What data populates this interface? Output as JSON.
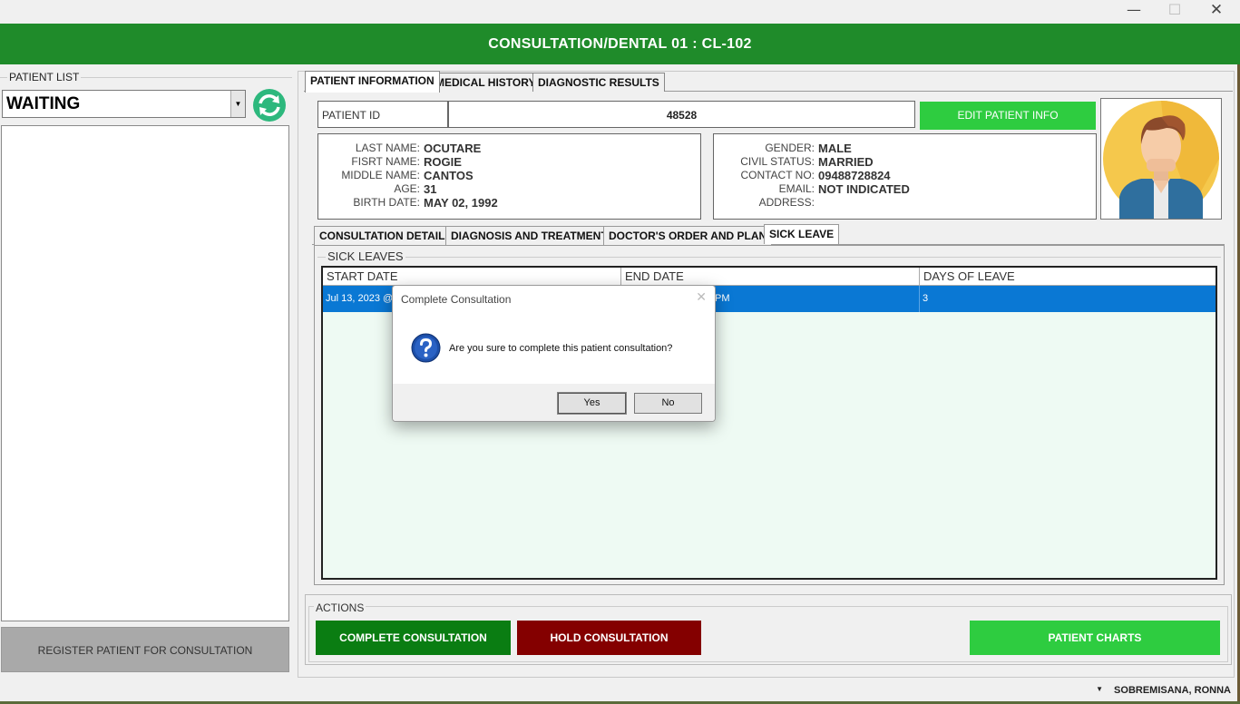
{
  "window": {
    "title": "CONSULTATION/DENTAL 01 : CL-102",
    "min_glyph": "—",
    "max_glyph": "☐",
    "close_glyph": "✕"
  },
  "patient_list": {
    "label": "PATIENT LIST",
    "filter_value": "WAITING",
    "dropdown_glyph": "▼",
    "refresh_icon": "refresh-icon",
    "register_button": "REGISTER PATIENT FOR CONSULTATION"
  },
  "tabs": [
    "PATIENT INFORMATION",
    "MEDICAL HISTORY",
    "DIAGNOSTIC RESULTS"
  ],
  "patient": {
    "id_label": "PATIENT ID",
    "id_value": "48528",
    "edit_button": "EDIT PATIENT INFO",
    "left_fields": [
      {
        "label": "LAST NAME:",
        "value": "OCUTARE"
      },
      {
        "label": "FISRT NAME:",
        "value": "ROGIE"
      },
      {
        "label": "MIDDLE NAME:",
        "value": "CANTOS"
      },
      {
        "label": "AGE:",
        "value": "31"
      },
      {
        "label": "BIRTH DATE:",
        "value": "MAY 02, 1992"
      }
    ],
    "right_fields": [
      {
        "label": "GENDER:",
        "value": "MALE"
      },
      {
        "label": "CIVIL STATUS:",
        "value": "MARRIED"
      },
      {
        "label": "CONTACT NO:",
        "value": "09488728824"
      },
      {
        "label": "EMAIL:",
        "value": "NOT INDICATED"
      },
      {
        "label": "ADDRESS:",
        "value": ""
      }
    ]
  },
  "sub_tabs": [
    "CONSULTATION DETAIL",
    "DIAGNOSIS AND TREATMENT",
    "DOCTOR'S ORDER AND PLAN",
    "SICK LEAVE"
  ],
  "sick_leave": {
    "group_label": "SICK LEAVES",
    "columns": [
      "START DATE",
      "END DATE",
      "DAYS OF LEAVE"
    ],
    "rows": [
      {
        "start": "Jul 13, 2023 @",
        "end": "PM",
        "days": "3"
      }
    ]
  },
  "actions": {
    "label": "ACTIONS",
    "complete": "COMPLETE CONSULTATION",
    "hold": "HOLD CONSULTATION",
    "charts": "PATIENT CHARTS"
  },
  "status": {
    "user": "SOBREMISANA, RONNA",
    "dropdown_glyph": "▼"
  },
  "dialog": {
    "title": "Complete Consultation",
    "message": "Are you sure to complete this patient consultation?",
    "yes": "Yes",
    "no": "No",
    "close_glyph": "✕",
    "icon": "question-icon"
  },
  "colors": {
    "header": "#1f8b2a",
    "complete": "#0a7d12",
    "hold": "#840000",
    "charts": "#2ecc40",
    "selected_row": "#0a78d4"
  }
}
